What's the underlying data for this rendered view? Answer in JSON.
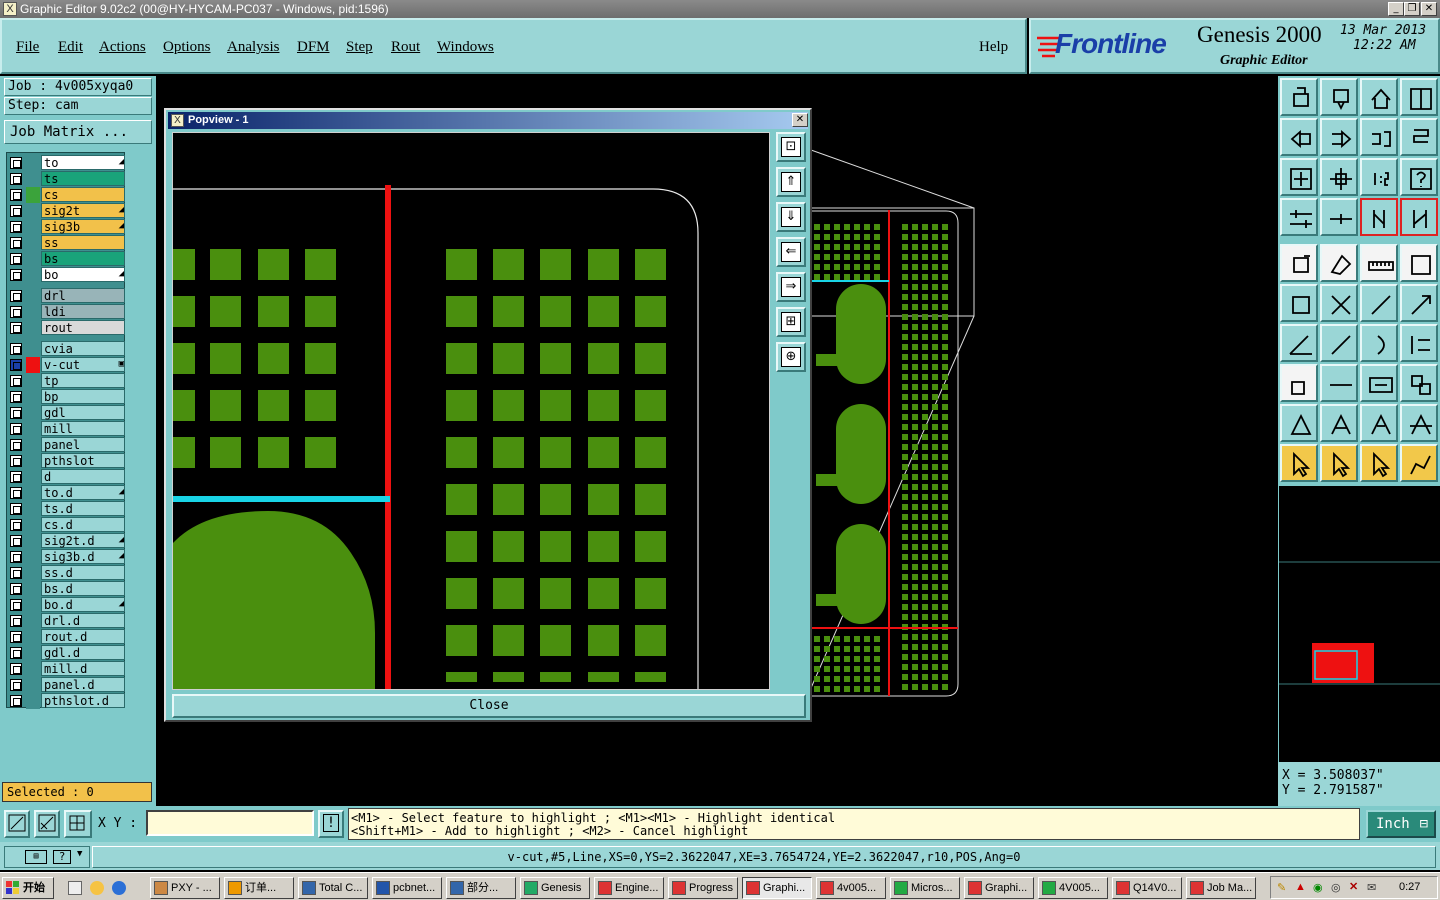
{
  "window": {
    "title": "Graphic Editor 9.02c2 (00@HY-HYCAM-PC037 - Windows, pid:1596)"
  },
  "menu": [
    {
      "label": "File",
      "name": "file"
    },
    {
      "label": "Edit",
      "name": "edit"
    },
    {
      "label": "Actions",
      "name": "actions"
    },
    {
      "label": "Options",
      "name": "options"
    },
    {
      "label": "Analysis",
      "name": "analysis"
    },
    {
      "label": "DFM",
      "name": "dfm"
    },
    {
      "label": "Step",
      "name": "step"
    },
    {
      "label": "Rout",
      "name": "rout"
    },
    {
      "label": "Windows",
      "name": "windows"
    }
  ],
  "help_label": "Help",
  "brand": {
    "logo": "Frontline",
    "product": "Genesis 2000",
    "subtitle": "Graphic Editor",
    "date": "13 Mar 2013",
    "time": "12:22 AM"
  },
  "job": {
    "label": "Job : 4v005xyqa0",
    "step": "Step: cam",
    "matrix_button": "Job Matrix ..."
  },
  "layers": [
    {
      "name": "to",
      "color": "#ffffff",
      "mark": "◢"
    },
    {
      "name": "ts",
      "color": "#1aa37a",
      "mark": ""
    },
    {
      "name": "cs",
      "color": "#f2c14a",
      "mark": "",
      "active": "#3ba33b"
    },
    {
      "name": "sig2t",
      "color": "#f2c14a",
      "mark": "◢"
    },
    {
      "name": "sig3b",
      "color": "#f2c14a",
      "mark": "◢"
    },
    {
      "name": "ss",
      "color": "#f2c14a",
      "mark": ""
    },
    {
      "name": "bs",
      "color": "#1aa37a",
      "mark": ""
    },
    {
      "name": "bo",
      "color": "#ffffff",
      "mark": "◢"
    },
    {
      "name": "drl",
      "color": "#98b4b8",
      "mark": "",
      "gap": true
    },
    {
      "name": "ldi",
      "color": "#98b4b8",
      "mark": ""
    },
    {
      "name": "rout",
      "color": "#d9d9d9",
      "mark": ""
    },
    {
      "name": "cvia",
      "color": "#9ad6d6",
      "mark": "",
      "gap": true
    },
    {
      "name": "v-cut",
      "color": "#9ad6d6",
      "mark": "▣",
      "active": "#ee1111",
      "sel": true
    },
    {
      "name": "tp",
      "color": "#9ad6d6",
      "mark": ""
    },
    {
      "name": "bp",
      "color": "#9ad6d6",
      "mark": ""
    },
    {
      "name": "gdl",
      "color": "#9ad6d6",
      "mark": ""
    },
    {
      "name": "mill",
      "color": "#9ad6d6",
      "mark": ""
    },
    {
      "name": "panel",
      "color": "#9ad6d6",
      "mark": ""
    },
    {
      "name": "pthslot",
      "color": "#9ad6d6",
      "mark": ""
    },
    {
      "name": "d",
      "color": "#9ad6d6",
      "mark": ""
    },
    {
      "name": "to.d",
      "color": "#9ad6d6",
      "mark": "◢"
    },
    {
      "name": "ts.d",
      "color": "#9ad6d6",
      "mark": ""
    },
    {
      "name": "cs.d",
      "color": "#9ad6d6",
      "mark": ""
    },
    {
      "name": "sig2t.d",
      "color": "#9ad6d6",
      "mark": "◢"
    },
    {
      "name": "sig3b.d",
      "color": "#9ad6d6",
      "mark": "◢"
    },
    {
      "name": "ss.d",
      "color": "#9ad6d6",
      "mark": ""
    },
    {
      "name": "bs.d",
      "color": "#9ad6d6",
      "mark": ""
    },
    {
      "name": "bo.d",
      "color": "#9ad6d6",
      "mark": "◢"
    },
    {
      "name": "drl.d",
      "color": "#9ad6d6",
      "mark": ""
    },
    {
      "name": "rout.d",
      "color": "#9ad6d6",
      "mark": ""
    },
    {
      "name": "gdl.d",
      "color": "#9ad6d6",
      "mark": ""
    },
    {
      "name": "mill.d",
      "color": "#9ad6d6",
      "mark": ""
    },
    {
      "name": "panel.d",
      "color": "#9ad6d6",
      "mark": ""
    },
    {
      "name": "pthslot.d",
      "color": "#9ad6d6",
      "mark": ""
    }
  ],
  "selected": "Selected : 0",
  "popview": {
    "title": "Popview - 1",
    "close_label": "Close"
  },
  "coords": {
    "x": "X = 3.508037\"",
    "y": "Y = 2.791587\""
  },
  "xy_label": "X Y :",
  "xy_value": "",
  "hint": {
    "line1": "<M1> - Select feature to highlight ; <M1><M1> - Highlight identical",
    "line2": "<Shift+M1> - Add to highlight ; <M2> - Cancel highlight"
  },
  "units": "Inch",
  "status": "v-cut,#5,Line,XS=0,YS=2.3622047,XE=3.7654724,YE=2.3622047,r10,POS,Ang=0",
  "taskbar": {
    "start": "开始",
    "clock": "0:27",
    "tasks": [
      {
        "label": "PXY - ...",
        "active": false
      },
      {
        "label": "订单...",
        "active": false
      },
      {
        "label": "Total C...",
        "active": false
      },
      {
        "label": "pcbnet...",
        "active": false
      },
      {
        "label": "部分...",
        "active": false
      },
      {
        "label": "Genesis",
        "active": false
      },
      {
        "label": "Engine...",
        "active": false
      },
      {
        "label": "Progress",
        "active": false
      },
      {
        "label": "Graphi...",
        "active": true
      },
      {
        "label": "4v005...",
        "active": false
      },
      {
        "label": "Micros...",
        "active": false
      },
      {
        "label": "Graphi...",
        "active": false
      },
      {
        "label": "4V005...",
        "active": false
      },
      {
        "label": "Q14V0...",
        "active": false
      },
      {
        "label": "Job Ma...",
        "active": false
      }
    ]
  },
  "colors": {
    "pad": "#4a8f0e",
    "vcut": "#ee1111",
    "highlight": "#19d4e6",
    "panel_bg": "#7fcaca",
    "button": "#9ad6d6"
  }
}
